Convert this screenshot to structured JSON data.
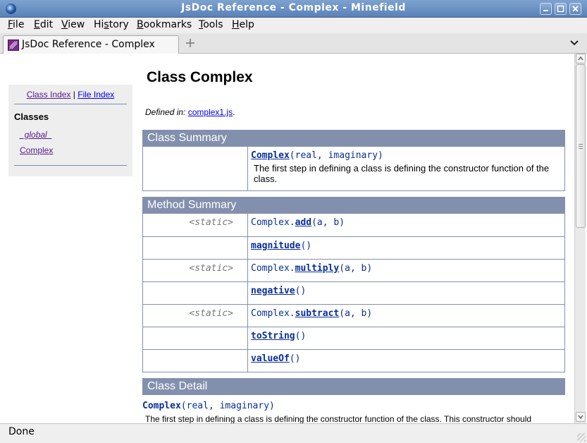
{
  "window": {
    "title": "JsDoc Reference - Complex - Minefield"
  },
  "menu": {
    "items": [
      {
        "label": "File",
        "u": "F",
        "rest": "ile"
      },
      {
        "label": "Edit",
        "u": "E",
        "rest": "dit"
      },
      {
        "label": "View",
        "u": "V",
        "rest": "iew"
      },
      {
        "label": "History",
        "pre": "Hi",
        "u": "s",
        "rest": "tory"
      },
      {
        "label": "Bookmarks",
        "u": "B",
        "rest": "ookmarks"
      },
      {
        "label": "Tools",
        "u": "T",
        "rest": "ools"
      },
      {
        "label": "Help",
        "u": "H",
        "rest": "elp"
      }
    ]
  },
  "tabs": [
    {
      "title": "JsDoc Reference - Complex"
    }
  ],
  "status": "Done",
  "sidebar": {
    "class_index": "Class Index",
    "separator": "|",
    "file_index": "File Index",
    "classes_heading": "Classes",
    "classes": [
      "_global_",
      "Complex"
    ]
  },
  "page": {
    "title": "Class Complex",
    "defined_in_label": "Defined in:",
    "defined_in_file": "complex1.js",
    "defined_in_period": "."
  },
  "class_summary": {
    "heading": "Class Summary",
    "signature_name": "Complex",
    "signature_params": "(real, imaginary)",
    "description": "The first step in defining a class is defining the constructor function of the class."
  },
  "method_summary": {
    "heading": "Method Summary",
    "rows": [
      {
        "modifier": "<static>",
        "prefix": "Complex.",
        "name": "add",
        "params": "(a, b)"
      },
      {
        "modifier": "",
        "prefix": "",
        "name": "magnitude",
        "params": "()"
      },
      {
        "modifier": "<static>",
        "prefix": "Complex.",
        "name": "multiply",
        "params": "(a, b)"
      },
      {
        "modifier": "",
        "prefix": "",
        "name": "negative",
        "params": "()"
      },
      {
        "modifier": "<static>",
        "prefix": "Complex.",
        "name": "subtract",
        "params": "(a, b)"
      },
      {
        "modifier": "",
        "prefix": "",
        "name": "toString",
        "params": "()"
      },
      {
        "modifier": "",
        "prefix": "",
        "name": "valueOf",
        "params": "()"
      }
    ]
  },
  "class_detail": {
    "heading": "Class Detail",
    "signature_name": "Complex",
    "signature_params": "(real, imaginary)",
    "description": "The first step in defining a class is defining the constructor function of the class. This constructor should"
  }
}
